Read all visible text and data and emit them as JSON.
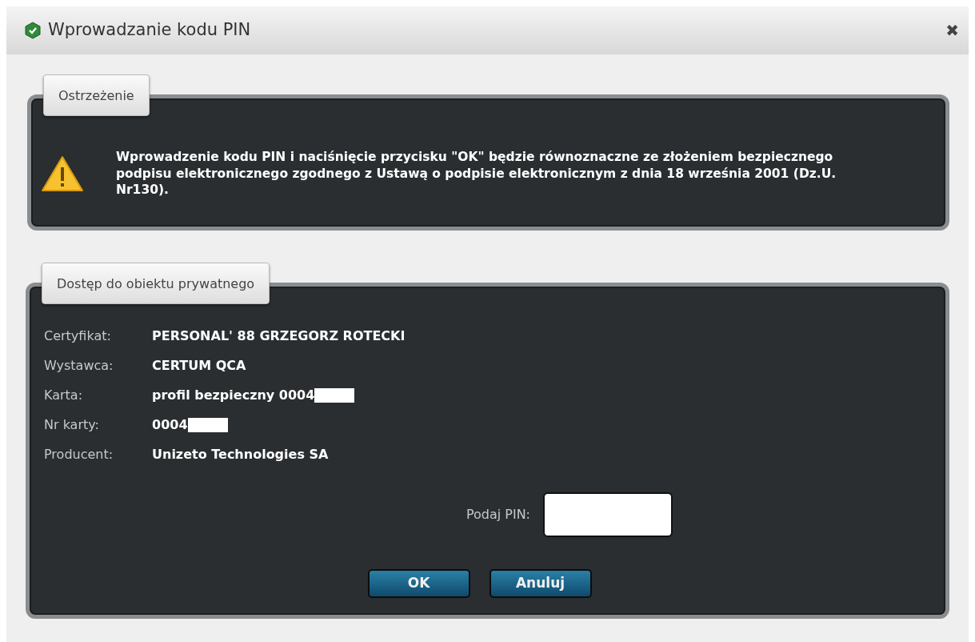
{
  "window": {
    "title": "Wprowadzanie kodu PIN",
    "close": "✖"
  },
  "warning": {
    "legend": "Ostrzeżenie",
    "message": "Wprowadzenie kodu PIN i naciśnięcie przycisku \"OK\" będzie równoznaczne ze złożeniem bezpiecznego podpisu elektronicznego zgodnego z Ustawą o podpisie elektronicznym z dnia 18 września 2001 (Dz.U. Nr130)."
  },
  "access": {
    "legend": "Dostęp do obiektu prywatnego",
    "fields": [
      {
        "label": "Certyfikat:",
        "value": "PERSONAL' 88 GRZEGORZ ROTECKI",
        "redacted": false
      },
      {
        "label": "Wystawca:",
        "value": "CERTUM QCA",
        "redacted": false
      },
      {
        "label": "Karta:",
        "value": "profil bezpieczny 0004",
        "redacted": true
      },
      {
        "label": "Nr karty:",
        "value": "0004",
        "redacted": true
      },
      {
        "label": "Producent:",
        "value": "Unizeto Technologies SA",
        "redacted": false
      }
    ],
    "pin": {
      "label": "Podaj PIN:"
    },
    "buttons": [
      "OK",
      "Anuluj"
    ]
  }
}
